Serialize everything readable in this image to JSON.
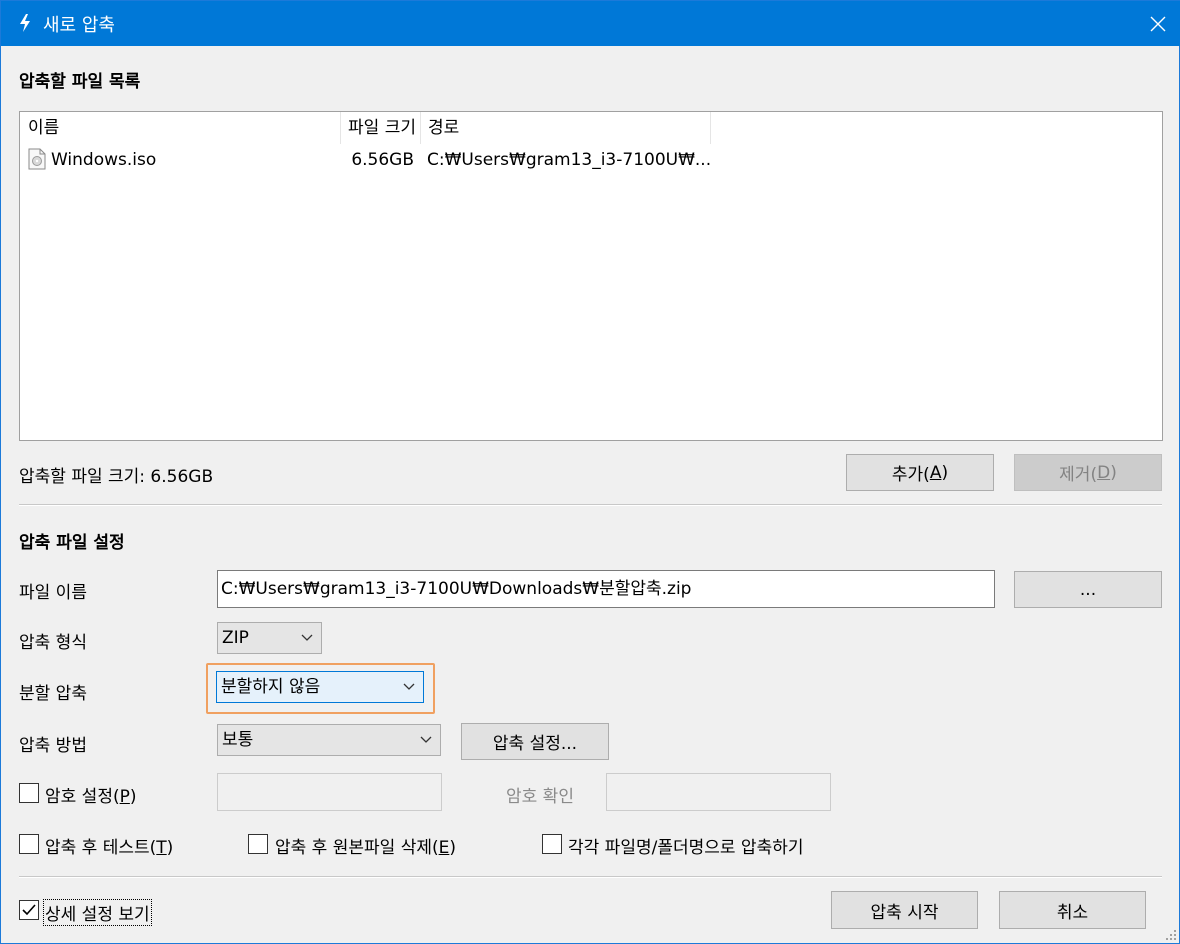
{
  "window": {
    "title": "새로 압축",
    "title_icon": "bolt-icon",
    "close_icon": "close-icon"
  },
  "file_list_section": {
    "title": "압축할 파일 목록",
    "columns": [
      "이름",
      "파일 크기",
      "경로"
    ],
    "rows": [
      {
        "name": "Windows.iso",
        "size": "6.56GB",
        "path": "C:₩Users₩gram13_i3-7100U₩...",
        "icon": "iso-file-icon"
      }
    ],
    "total_label": "압축할 파일 크기: 6.56GB",
    "add_button": {
      "label": "추가(",
      "mnemonic": "A",
      "suffix": ")"
    },
    "remove_button": {
      "label": "제거(",
      "mnemonic": "D",
      "suffix": ")"
    }
  },
  "settings_section": {
    "title": "압축 파일 설정",
    "filename_label": "파일 이름",
    "filename_value": "C:₩Users₩gram13_i3-7100U₩Downloads₩분할압축.zip",
    "browse_label": "...",
    "format_label": "압축 형식",
    "format_value": "ZIP",
    "split_label": "분할 압축",
    "split_value": "분할하지 않음",
    "method_label": "압축 방법",
    "method_value": "보통",
    "method_settings_label": "압축 설정...",
    "password_label": "암호 설정(",
    "password_mnemonic": "P",
    "password_suffix": ")",
    "password_checked": false,
    "password_confirm_label": "암호 확인",
    "test_label": "압축 후 테스트(",
    "test_mnemonic": "T",
    "test_suffix": ")",
    "test_checked": false,
    "delete_label": "압축 후 원본파일 삭제(",
    "delete_mnemonic": "E",
    "delete_suffix": ")",
    "delete_checked": false,
    "each_label": "각각 파일명/폴더명으로 압축하기",
    "each_checked": false
  },
  "footer": {
    "details_label": "상세 설정 보기",
    "details_checked": true,
    "start_label": "압축 시작",
    "cancel_label": "취소"
  },
  "colors": {
    "titlebar": "#0078d7",
    "highlight": "#f0a060",
    "focus": "#0078d7"
  }
}
